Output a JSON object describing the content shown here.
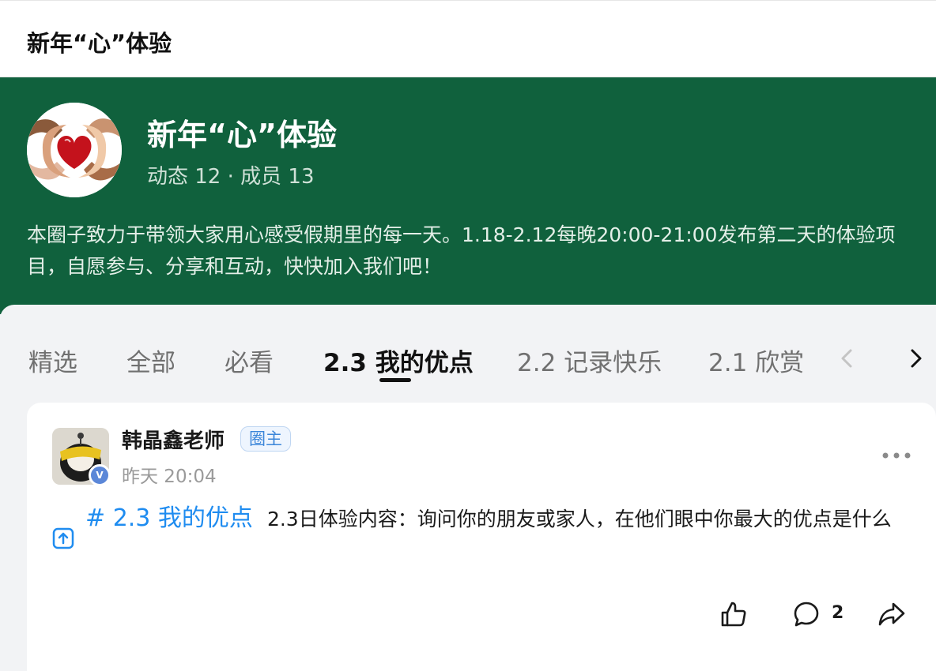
{
  "topbar": {
    "title": "新年“心”体验"
  },
  "group": {
    "name": "新年“心”体验",
    "stats": "动态 12 · 成员 13",
    "description": "本圈子致力于带领大家用心感受假期里的每一天。1.18-2.12每晚20:00-21:00发布第二天的体验项目，自愿参与、分享和互动，快快加入我们吧！"
  },
  "tabs": [
    {
      "label": "精选"
    },
    {
      "label": "全部"
    },
    {
      "label": "必看"
    },
    {
      "label": "2.3 我的优点",
      "active": true
    },
    {
      "label": "2.2 记录快乐"
    },
    {
      "label": "2.1 欣赏"
    }
  ],
  "post": {
    "author": "韩晶鑫老师",
    "badge": "圈主",
    "time": "昨天 20:04",
    "topic_hash": "#",
    "topic_name": "2.3 我的优点",
    "content": "2.3日体验内容：询问你的朋友或家人，在他们眼中你最大的优点是什么",
    "comment_count": "2"
  },
  "icons": {
    "prev": "chevron-left-icon",
    "next": "chevron-right-icon",
    "more": "more-icon",
    "pin": "pin-top-icon",
    "like": "thumbs-up-icon",
    "comment": "comment-icon",
    "share": "share-icon"
  },
  "colors": {
    "banner": "#10613d",
    "accent": "#1f8cf0",
    "owner_badge": "#3b86d9"
  }
}
